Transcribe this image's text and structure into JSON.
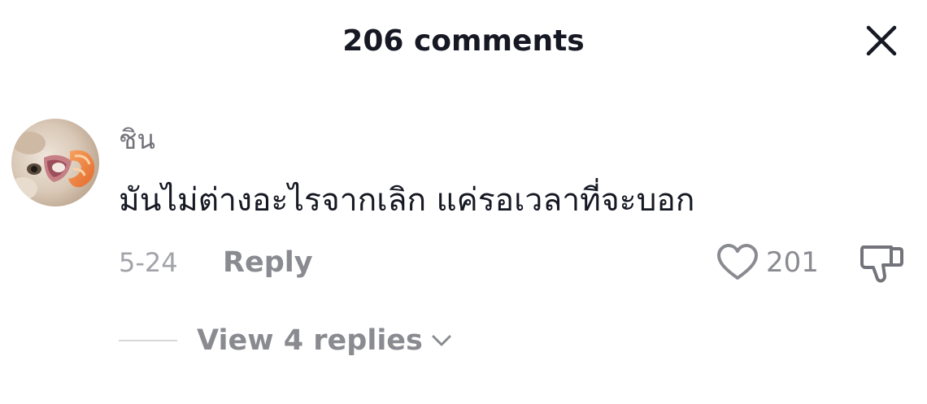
{
  "header": {
    "title": "206 comments",
    "close_icon": "close-icon"
  },
  "comment": {
    "avatar_icon": "user-avatar",
    "username": "ชิน",
    "text": "มันไม่ต่างอะไรจากเลิก แค่รอเวลาที่จะบอก",
    "date": "5-24",
    "reply_label": "Reply",
    "like_icon": "heart-outline-icon",
    "like_count": "201",
    "dislike_icon": "thumbs-down-icon"
  },
  "replies": {
    "label": "View 4 replies",
    "icon": "chevron-down-icon"
  },
  "colors": {
    "primary_text": "#161823",
    "secondary_text": "#73747b",
    "muted_text": "#8a8b91",
    "date_text": "#a2a3a8",
    "divider": "#d8d8da"
  }
}
